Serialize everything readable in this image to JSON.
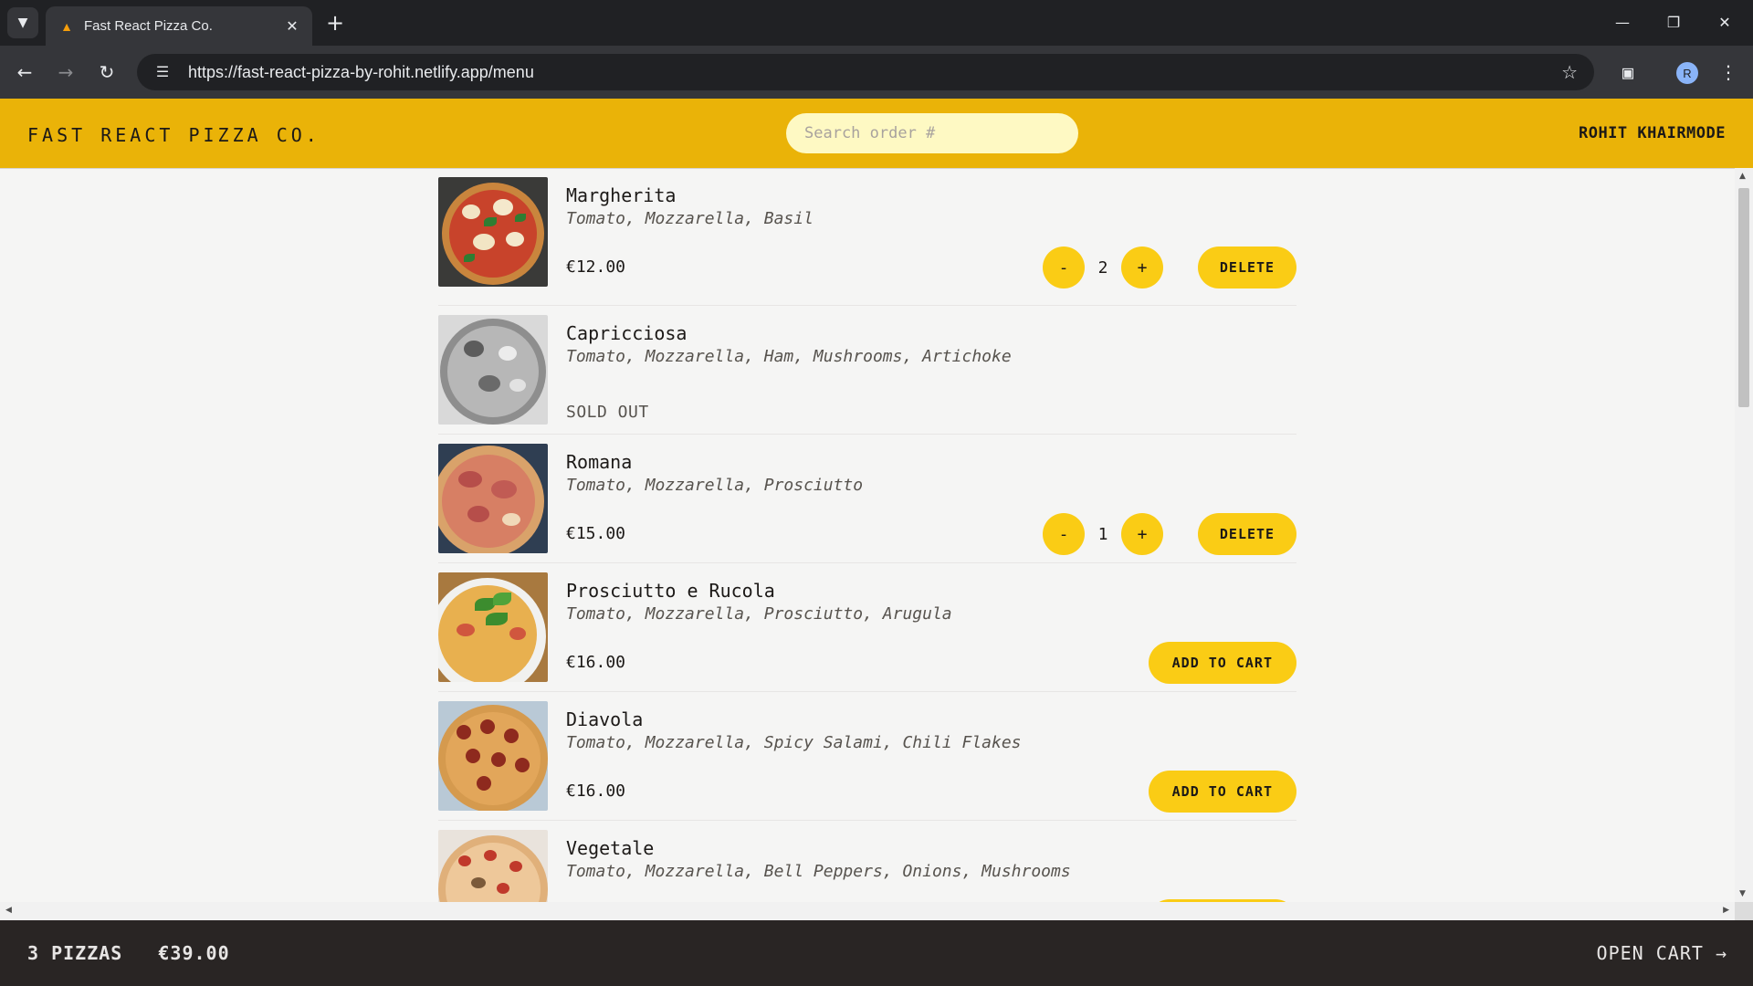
{
  "browser": {
    "tab_title": "Fast React Pizza Co.",
    "url": "https://fast-react-pizza-by-rohit.netlify.app/menu",
    "profile_initial": "R"
  },
  "header": {
    "logo": "Fast React Pizza Co.",
    "search_placeholder": "Search order #",
    "username": "ROHIT KHAIRMODE"
  },
  "menu": [
    {
      "name": "Margherita",
      "ingredients": "Tomato, Mozzarella, Basil",
      "price": "€12.00",
      "sold_out": false,
      "quantity": "2",
      "in_cart": true
    },
    {
      "name": "Capricciosa",
      "ingredients": "Tomato, Mozzarella, Ham, Mushrooms, Artichoke",
      "price": "",
      "sold_out": true,
      "sold_out_label": "SOLD OUT"
    },
    {
      "name": "Romana",
      "ingredients": "Tomato, Mozzarella, Prosciutto",
      "price": "€15.00",
      "sold_out": false,
      "quantity": "1",
      "in_cart": true
    },
    {
      "name": "Prosciutto e Rucola",
      "ingredients": "Tomato, Mozzarella, Prosciutto, Arugula",
      "price": "€16.00",
      "sold_out": false,
      "in_cart": false
    },
    {
      "name": "Diavola",
      "ingredients": "Tomato, Mozzarella, Spicy Salami, Chili Flakes",
      "price": "€16.00",
      "sold_out": false,
      "in_cart": false
    },
    {
      "name": "Vegetale",
      "ingredients": "Tomato, Mozzarella, Bell Peppers, Onions, Mushrooms",
      "price": "",
      "sold_out": false,
      "in_cart": false
    }
  ],
  "buttons": {
    "decrease": "-",
    "increase": "+",
    "delete": "DELETE",
    "add_to_cart": "ADD TO CART"
  },
  "cart": {
    "count": "3 PIZZAS",
    "total": "€39.00",
    "open_cart": "OPEN CART →"
  },
  "colors": {
    "header_bg": "#eab308",
    "button_bg": "#facc15",
    "cart_bar_bg": "#292524"
  }
}
